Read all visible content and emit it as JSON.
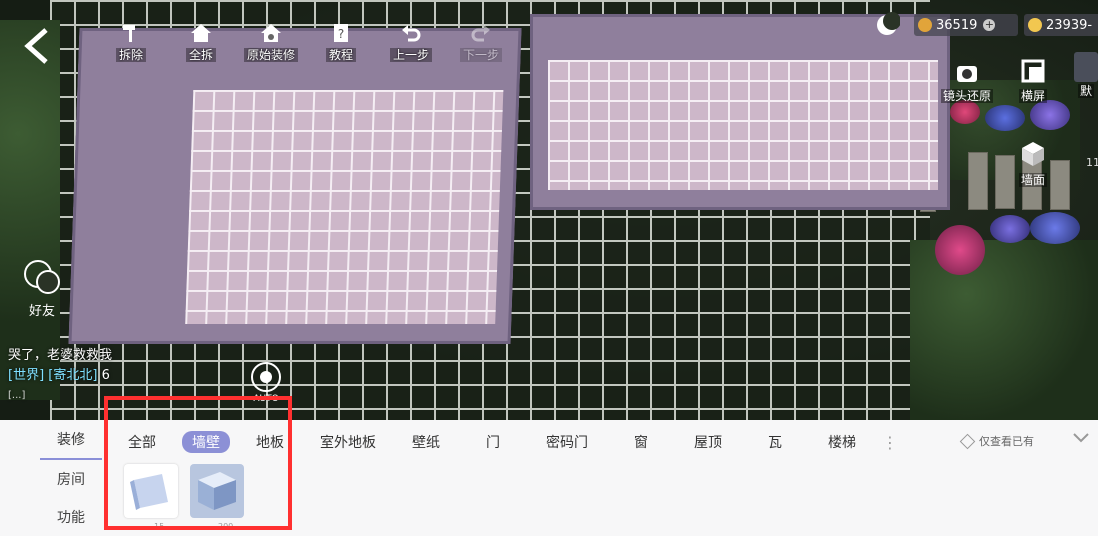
{
  "toolbar": {
    "items": [
      {
        "label": "拆除",
        "icon": "hammer-icon"
      },
      {
        "label": "全拆",
        "icon": "house-demolish-icon"
      },
      {
        "label": "原始装修",
        "icon": "house-restore-icon"
      },
      {
        "label": "教程",
        "icon": "tutorial-book-icon"
      },
      {
        "label": "上一步",
        "icon": "undo-icon"
      },
      {
        "label": "下一步",
        "icon": "redo-icon"
      }
    ]
  },
  "currency": {
    "gold": "36519",
    "diamond": "23939-"
  },
  "right_tools": {
    "camera_reset": "镜头还原",
    "landscape": "横屏",
    "default": "默",
    "wall": "墙面",
    "side_number": "11"
  },
  "friends": {
    "label": "好友"
  },
  "chat": {
    "line1": "哭了，老婆救救我",
    "channel": "[世界]",
    "user": "[寄北北]",
    "count": "6",
    "partial": "[...]"
  },
  "auto_label": "AUTO",
  "bottom_panel": {
    "side_nav": [
      "装修",
      "房间",
      "功能"
    ],
    "active_side": "装修",
    "tabs": [
      "全部",
      "墙壁",
      "地板",
      "室外地板",
      "壁纸",
      "门",
      "密码门",
      "窗",
      "屋顶",
      "瓦",
      "楼梯"
    ],
    "active_tab": "墙壁",
    "filter_label": "仅查看已有",
    "items": [
      {
        "name": "wall-item-1",
        "price": "15"
      },
      {
        "name": "wall-item-2",
        "price": "200"
      }
    ]
  },
  "colors": {
    "active_tab": "#8c90d6",
    "highlight_box": "#ff3030",
    "room_wall": "#8f7f9c",
    "room_floor": "#cdb7c9"
  }
}
